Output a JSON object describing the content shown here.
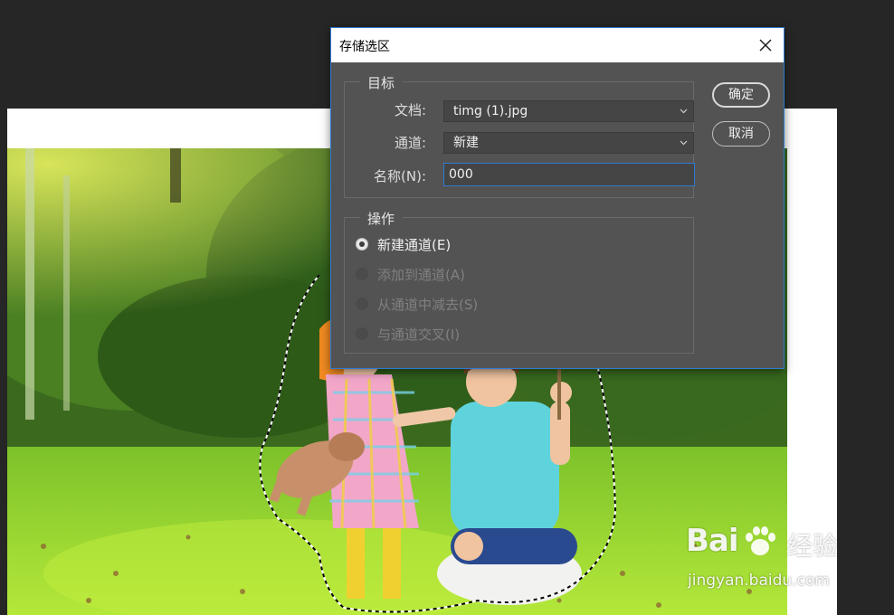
{
  "dialog": {
    "title": "存储选区",
    "target_group": {
      "legend": "目标",
      "document_label": "文档:",
      "document_value": "timg (1).jpg",
      "channel_label": "通道:",
      "channel_value": "新建",
      "name_label": "名称(N):",
      "name_value": "000"
    },
    "operation_group": {
      "legend": "操作",
      "options": [
        {
          "label": "新建通道(E)",
          "selected": true,
          "enabled": true
        },
        {
          "label": "添加到通道(A)",
          "selected": false,
          "enabled": false
        },
        {
          "label": "从通道中减去(S)",
          "selected": false,
          "enabled": false
        },
        {
          "label": "与通道交叉(I)",
          "selected": false,
          "enabled": false
        }
      ]
    },
    "buttons": {
      "ok": "确定",
      "cancel": "取消"
    }
  },
  "watermark": {
    "logo": "Bai",
    "logo_suffix": "经验",
    "url": "jingyan.baidu.com"
  },
  "colors": {
    "workspace_bg": "#262626",
    "dialog_bg": "#535353",
    "accent": "#2f7ad1"
  }
}
